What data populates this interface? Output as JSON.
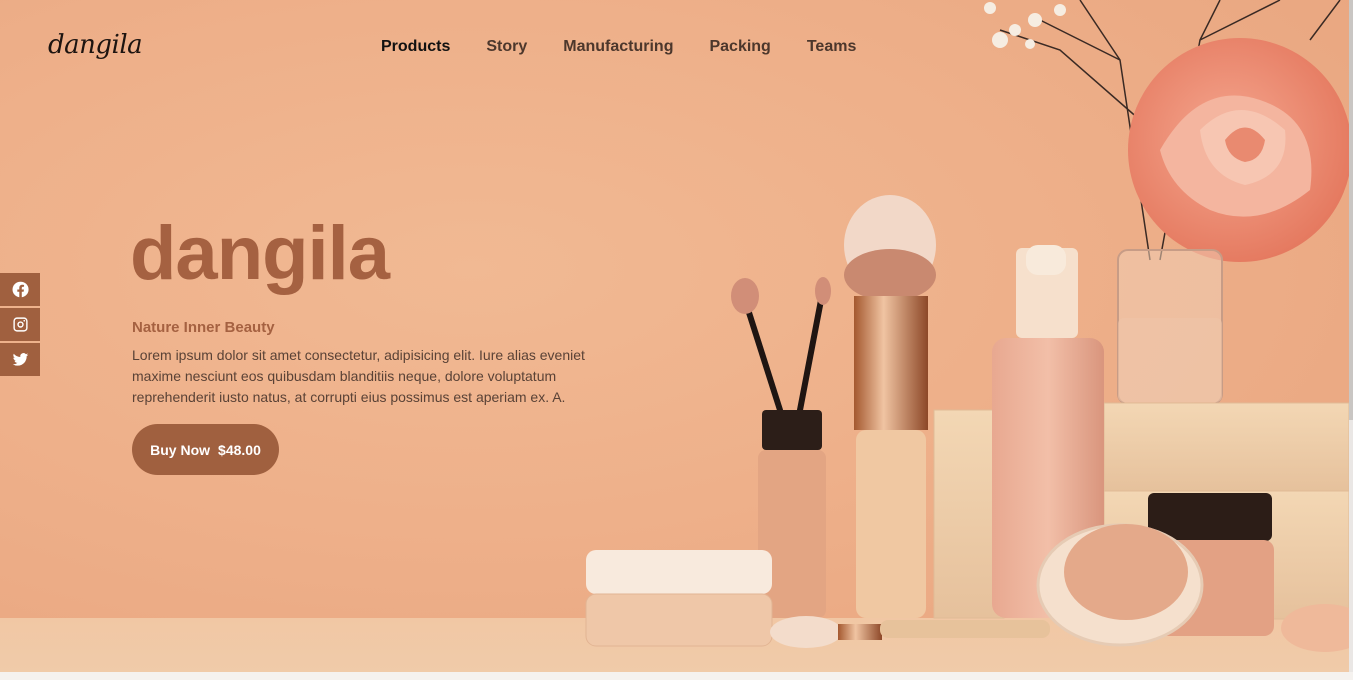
{
  "brand": {
    "logo": "dangila"
  },
  "nav": {
    "items": [
      {
        "label": "Products",
        "active": true
      },
      {
        "label": "Story"
      },
      {
        "label": "Manufacturing"
      },
      {
        "label": "Packing"
      },
      {
        "label": "Teams"
      }
    ]
  },
  "social": [
    "facebook-icon",
    "instagram-icon",
    "twitter-icon"
  ],
  "hero": {
    "title": "dangila",
    "subtitle": "Nature Inner Beauty",
    "description": "Lorem ipsum dolor sit amet consectetur, adipisicing elit. Iure alias eveniet maxime nesciunt eos quibusdam blanditiis neque, dolore voluptatum reprehenderit iusto natus, at corrupti eius possimus est aperiam ex. A.",
    "button_label": "Buy Now",
    "price": "$48.00"
  },
  "colors": {
    "accent": "#a0603f",
    "background": "#efb48e",
    "heading": "#a56141"
  }
}
